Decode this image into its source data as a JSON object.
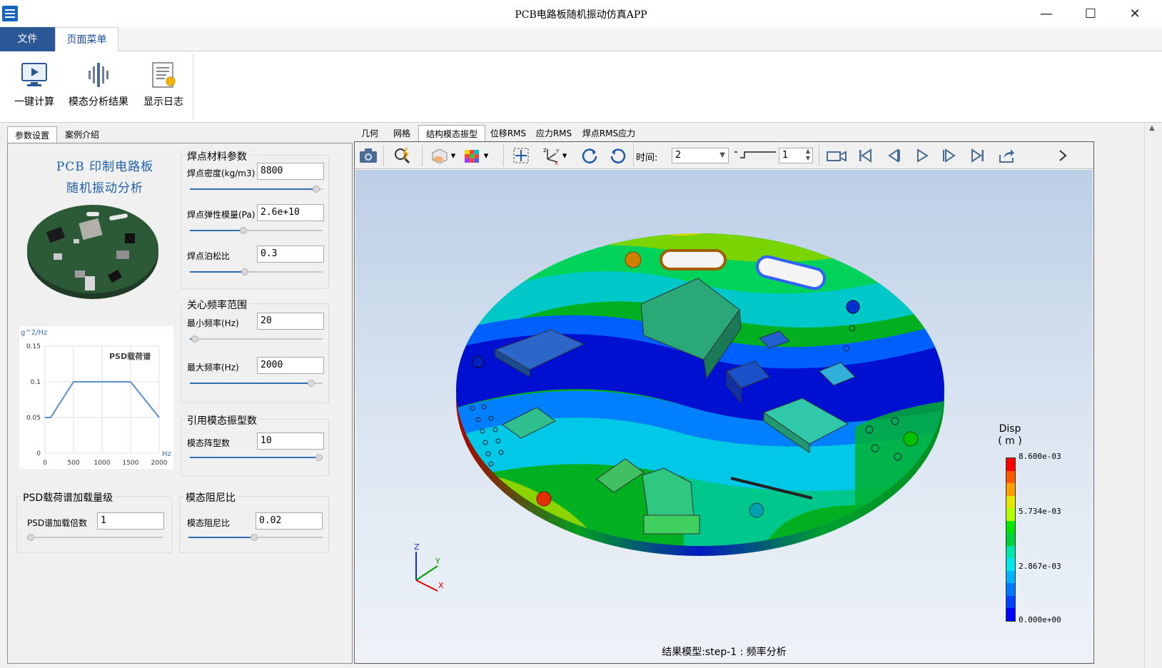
{
  "window": {
    "title": "PCB电路板随机振动仿真APP"
  },
  "menu": {
    "file": "文件",
    "page_menu": "页面菜单"
  },
  "ribbon": {
    "compute": "一键计算",
    "modal_results": "模态分析结果",
    "show_log": "显示日志"
  },
  "left_tabs": [
    "参数设置",
    "案例介绍"
  ],
  "pcb_title": [
    "PCB 印制电路板",
    "随机振动分析"
  ],
  "psd_chart": {
    "chart_data": {
      "type": "line",
      "title": "PSD载荷谱",
      "ylabel": "g^2/Hz",
      "xlabel": "Hz",
      "x": [
        0,
        100,
        500,
        1500,
        2000
      ],
      "y": [
        0.05,
        0.05,
        0.1,
        0.1,
        0.05
      ],
      "xlim": [
        0,
        2000
      ],
      "ylim": [
        0,
        0.15
      ],
      "xticks": [
        "0",
        "500",
        "1000",
        "1500",
        "2000"
      ],
      "yticks": [
        "0",
        "0.05",
        "0.1",
        "0.15"
      ],
      "series_color": "#5b8ecf",
      "grid": true
    }
  },
  "solder": {
    "title": "焊点材料参数",
    "density_label": "焊点密度(kg/m3)",
    "density_value": "8800",
    "density_pos": 0.98,
    "modulus_label": "焊点弹性模量(Pa)",
    "modulus_value": "2.6e+10",
    "modulus_pos": 0.4,
    "poisson_label": "焊点泊松比",
    "poisson_value": "0.3",
    "poisson_pos": 0.41
  },
  "freq": {
    "title": "关心频率范围",
    "min_label": "最小频率(Hz)",
    "min_value": "20",
    "min_pos": 0.01,
    "max_label": "最大频率(Hz)",
    "max_value": "2000",
    "max_pos": 0.94
  },
  "modes": {
    "title": "引用模态振型数",
    "count_label": "模态阵型数",
    "count_value": "10",
    "count_pos": 1.0
  },
  "psd_level": {
    "title": "PSD载荷谱加载量级",
    "factor_label": "PSD谱加载倍数",
    "factor_value": "1",
    "factor_pos": 0.0
  },
  "damping": {
    "title": "模态阻尼比",
    "ratio_label": "模态阻尼比",
    "ratio_value": "0.02",
    "ratio_pos": 0.49
  },
  "right_tabs": [
    "几何",
    "网格",
    "结构模态振型",
    "位移RMS",
    "应力RMS",
    "焊点RMS应力"
  ],
  "toolbar": {
    "time_label": "时间:",
    "time_value": "2",
    "step_value": "1"
  },
  "legend": {
    "title": "Disp",
    "unit": "( m )",
    "labels": [
      "8.600e-03",
      "5.734e-03",
      "2.867e-03",
      "0.000e+00"
    ],
    "colors": [
      "#ff0000",
      "#ff5a00",
      "#ffa000",
      "#e6e600",
      "#b4ff00",
      "#00e600",
      "#00d23c",
      "#00e6aa",
      "#00e6e6",
      "#00b4ff",
      "#0078ff",
      "#0040ff",
      "#0000ff"
    ]
  },
  "axis_triad": {
    "x": "X",
    "y": "Y",
    "z": "Z"
  },
  "status": "结果模型:step-1 : 频率分析"
}
